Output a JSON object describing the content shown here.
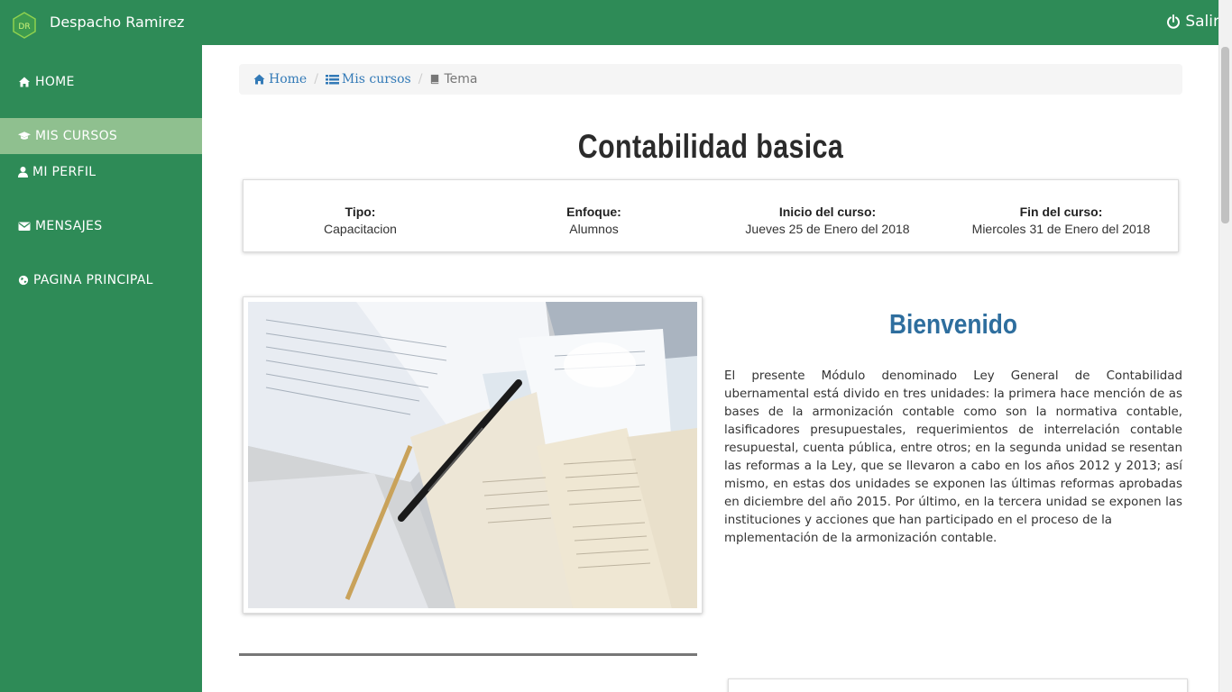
{
  "header": {
    "brand_name": "Despacho Ramirez",
    "logo_text": "DR",
    "logout_label": "Salir"
  },
  "sidebar": {
    "items": [
      {
        "label": "HOME",
        "icon": "home-icon"
      },
      {
        "label": "MIS CURSOS",
        "icon": "graduation-cap-icon",
        "active": true
      },
      {
        "label": "MI PERFIL",
        "icon": "user-icon"
      },
      {
        "label": "MENSAJES",
        "icon": "envelope-icon"
      },
      {
        "label": "PAGINA PRINCIPAL",
        "icon": "globe-icon"
      }
    ]
  },
  "breadcrumb": {
    "home": "Home",
    "courses": "Mis cursos",
    "current": "Tema"
  },
  "course": {
    "title": "Contabilidad basica",
    "info": [
      {
        "label": "Tipo:",
        "value": "Capacitacion"
      },
      {
        "label": "Enfoque:",
        "value": "Alumnos"
      },
      {
        "label": "Inicio del curso:",
        "value": "Jueves 25 de Enero del 2018"
      },
      {
        "label": "Fin del curso:",
        "value": "Miercoles 31 de Enero del 2018"
      }
    ]
  },
  "welcome": {
    "title": "Bienvenido",
    "body": "El presente Módulo denominado Ley General de Contabilidad ubernamental está divido en tres unidades: la primera hace mención de as bases de la armonización contable como son la normativa contable, lasificadores presupuestales, requerimientos de interrelación contable resupuestal, cuenta pública, entre otros; en la segunda unidad se resentan las reformas a la Ley, que se llevaron a cabo en los años 2012 y 2013; así mismo, en estas dos unidades se exponen las últimas reformas aprobadas en diciembre del año 2015. Por último, en la tercera unidad se exponen las instituciones y acciones que han participado en el proceso de la",
    "body_last": "mplementación de la armonización contable."
  },
  "colors": {
    "primary_green": "#2e8b57",
    "active_item": "#8fc08f",
    "link_blue": "#337ab7",
    "heading_blue": "#2e6e9e"
  }
}
